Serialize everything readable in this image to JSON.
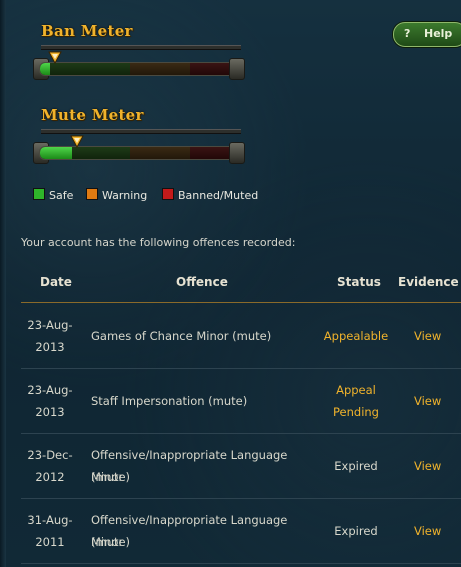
{
  "meters": {
    "ban": {
      "title": "Ban Meter",
      "level": 0.05
    },
    "mute": {
      "title": "Mute Meter",
      "level": 0.16
    }
  },
  "legend": [
    {
      "label": "Safe",
      "color": "#2fb52a"
    },
    {
      "label": "Warning",
      "color": "#e07b12"
    },
    {
      "label": "Banned/Muted",
      "color": "#c21a1a"
    }
  ],
  "help": {
    "icon": "?",
    "label": "Help"
  },
  "intro": "Your account has the following offences recorded:",
  "table": {
    "headers": {
      "date": "Date",
      "offence": "Offence",
      "status": "Status",
      "evidence": "Evidence"
    },
    "rows": [
      {
        "date1": "23-Aug-",
        "date2": "2013",
        "offence1": "Games of Chance Minor (mute)",
        "offence2": "",
        "status1": "Appealable",
        "status2": "",
        "evidence": "View"
      },
      {
        "date1": "23-Aug-",
        "date2": "2013",
        "offence1": "Staff Impersonation (mute)",
        "offence2": "",
        "status1": "Appeal",
        "status2": "Pending",
        "evidence": "View"
      },
      {
        "date1": "23-Dec-",
        "date2": "2012",
        "offence1": "Offensive/Inappropriate Language Minor",
        "offence2": "(mute)",
        "status1": "Expired",
        "status2": "",
        "evidence": "View"
      },
      {
        "date1": "31-Aug-",
        "date2": "2011",
        "offence1": "Offensive/Inappropriate Language Minor",
        "offence2": "(mute)",
        "status1": "Expired",
        "status2": "",
        "evidence": "View"
      }
    ]
  }
}
